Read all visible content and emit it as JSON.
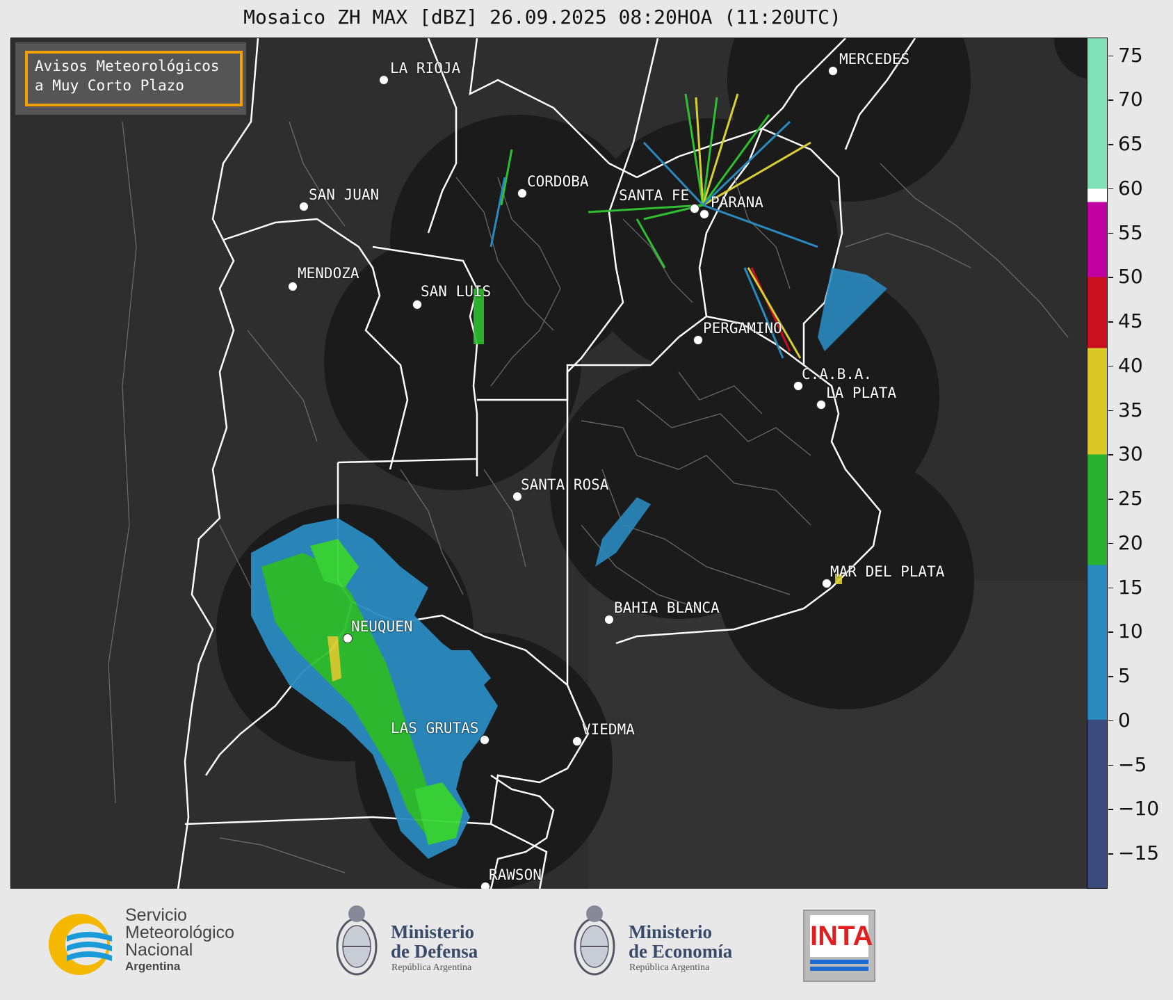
{
  "title": "Mosaico ZH MAX [dBZ] 26.09.2025 08:20HOA (11:20UTC)",
  "badge": {
    "line1": "Avisos Meteorológicos",
    "line2": "a Muy Corto Plazo"
  },
  "cities": [
    {
      "name": "LA RIOJA"
    },
    {
      "name": "MERCEDES"
    },
    {
      "name": "CORDOBA"
    },
    {
      "name": "SAN JUAN"
    },
    {
      "name": "SANTA FE"
    },
    {
      "name": "PARANA"
    },
    {
      "name": "MENDOZA"
    },
    {
      "name": "SAN LUIS"
    },
    {
      "name": "PERGAMINO"
    },
    {
      "name": "C.A.B.A."
    },
    {
      "name": "LA PLATA"
    },
    {
      "name": "SANTA ROSA"
    },
    {
      "name": "MAR DEL PLATA"
    },
    {
      "name": "BAHIA BLANCA"
    },
    {
      "name": "NEUQUEN"
    },
    {
      "name": "LAS GRUTAS"
    },
    {
      "name": "VIEDMA"
    },
    {
      "name": "RAWSON"
    }
  ],
  "colorbar": {
    "unit": "dBZ",
    "range": [
      -19,
      77
    ],
    "ticks": [
      "75",
      "70",
      "65",
      "60",
      "55",
      "50",
      "45",
      "40",
      "35",
      "30",
      "25",
      "20",
      "15",
      "10",
      "5",
      "0",
      "−5",
      "−10",
      "−15"
    ],
    "stops": [
      {
        "from": -19,
        "to": 0,
        "color": "#3a4a7a"
      },
      {
        "from": 0,
        "to": 17.5,
        "color": "#2a8ac0"
      },
      {
        "from": 17.5,
        "to": 30,
        "color": "#2ab030"
      },
      {
        "from": 30,
        "to": 42,
        "color": "#d8c828"
      },
      {
        "from": 42,
        "to": 50,
        "color": "#c81020"
      },
      {
        "from": 50,
        "to": 58.5,
        "color": "#c000a0"
      },
      {
        "from": 58.5,
        "to": 60,
        "color": "#ffffff"
      },
      {
        "from": 60,
        "to": 77,
        "color": "#80e0b8"
      }
    ]
  },
  "footer": {
    "smn_line1": "Servicio",
    "smn_line2": "Meteorológico",
    "smn_line3": "Nacional",
    "smn_line4": "Argentina",
    "defensa_line1": "Ministerio",
    "defensa_line2": "de Defensa",
    "defensa_sub": "República Argentina",
    "economia_line1": "Ministerio",
    "economia_line2": "de Economía",
    "economia_sub": "República Argentina",
    "inta": "INTA"
  },
  "colors": {
    "map_bg": "#2e2e2e",
    "radar_disc": "#1b1b1b",
    "echo_green": "#2ec030",
    "echo_blue": "#2a8ac0",
    "badge_border": "#f0a000"
  }
}
